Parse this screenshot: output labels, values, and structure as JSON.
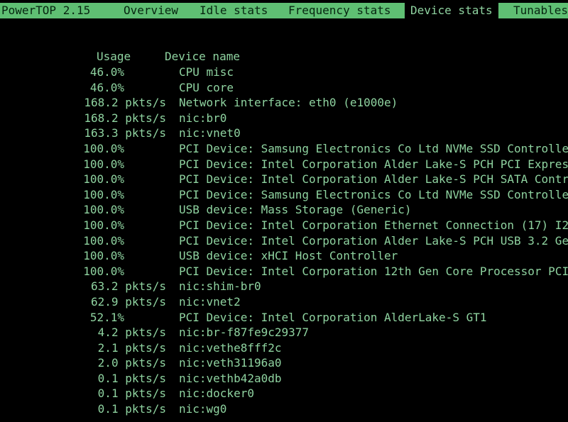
{
  "topbar": {
    "app_title": "PowerTOP 2.15",
    "tabs": [
      {
        "label": "Overview"
      },
      {
        "label": "Idle stats"
      },
      {
        "label": "Frequency stats"
      },
      {
        "label": "Device stats"
      },
      {
        "label": "Tunables"
      }
    ],
    "active_tab": "Device stats"
  },
  "table": {
    "headers": {
      "usage": "Usage",
      "device": "Device name"
    },
    "rows": [
      {
        "usage": "46.0%",
        "device": "CPU misc"
      },
      {
        "usage": "46.0%",
        "device": "CPU core"
      },
      {
        "usage": "168.2 pkts/s",
        "device": "Network interface: eth0 (e1000e)"
      },
      {
        "usage": "168.2 pkts/s",
        "device": "nic:br0"
      },
      {
        "usage": "163.3 pkts/s",
        "device": "nic:vnet0"
      },
      {
        "usage": "100.0%",
        "device": "PCI Device: Samsung Electronics Co Ltd NVMe SSD Controlle"
      },
      {
        "usage": "100.0%",
        "device": "PCI Device: Intel Corporation Alder Lake-S PCH PCI Expres"
      },
      {
        "usage": "100.0%",
        "device": "PCI Device: Intel Corporation Alder Lake-S PCH SATA Contr"
      },
      {
        "usage": "100.0%",
        "device": "PCI Device: Samsung Electronics Co Ltd NVMe SSD Controlle"
      },
      {
        "usage": "100.0%",
        "device": "USB device: Mass Storage (Generic)"
      },
      {
        "usage": "100.0%",
        "device": "PCI Device: Intel Corporation Ethernet Connection (17) I2"
      },
      {
        "usage": "100.0%",
        "device": "PCI Device: Intel Corporation Alder Lake-S PCH USB 3.2 Ge"
      },
      {
        "usage": "100.0%",
        "device": "USB device: xHCI Host Controller"
      },
      {
        "usage": "100.0%",
        "device": "PCI Device: Intel Corporation 12th Gen Core Processor PCI"
      },
      {
        "usage": "63.2 pkts/s",
        "device": "nic:shim-br0"
      },
      {
        "usage": "62.9 pkts/s",
        "device": "nic:vnet2"
      },
      {
        "usage": "52.1%",
        "device": "PCI Device: Intel Corporation AlderLake-S GT1"
      },
      {
        "usage": "4.2 pkts/s",
        "device": "nic:br-f87fe9c29377"
      },
      {
        "usage": "2.1 pkts/s",
        "device": "nic:vethe8fff2c"
      },
      {
        "usage": "2.0 pkts/s",
        "device": "nic:veth31196a0"
      },
      {
        "usage": "0.1 pkts/s",
        "device": "nic:vethb42a0db"
      },
      {
        "usage": "0.1 pkts/s",
        "device": "nic:docker0"
      },
      {
        "usage": "0.1 pkts/s",
        "device": "nic:wg0"
      }
    ]
  },
  "colors": {
    "background": "#000000",
    "text": "#8fd3a0",
    "topbar_bg": "#5fbf73",
    "topbar_text": "#062510"
  }
}
